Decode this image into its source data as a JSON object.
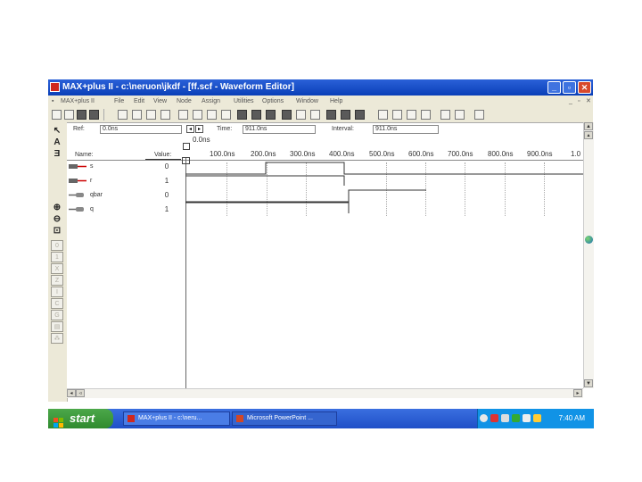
{
  "window": {
    "title": "MAX+plus II - c:\\neruon\\jkdf - [ff.scf - Waveform Editor]",
    "buttons": {
      "minimize": "_",
      "maximize": "▫",
      "close": "✕"
    }
  },
  "menu": {
    "items": [
      "MAX+plus II",
      "File",
      "Edit",
      "View",
      "Node",
      "Assign",
      "Utilities",
      "Options",
      "Window",
      "Help"
    ]
  },
  "fields": {
    "ref_label": "Ref:",
    "ref_value": "0.0ns",
    "time_label": "Time:",
    "time_value": "911.0ns",
    "interval_label": "Interval:",
    "interval_value": "911.0ns",
    "cursor_time": "0.0ns"
  },
  "columns": {
    "name": "Name:",
    "value": "Value:"
  },
  "signals": [
    {
      "name": "s",
      "value": "0",
      "type": "input"
    },
    {
      "name": "r",
      "value": "1",
      "type": "input"
    },
    {
      "name": "qbar",
      "value": "0",
      "type": "output"
    },
    {
      "name": "q",
      "value": "1",
      "type": "output"
    }
  ],
  "timescale": [
    "100.0ns",
    "200.0ns",
    "300.0ns",
    "400.0ns",
    "500.0ns",
    "600.0ns",
    "700.0ns",
    "800.0ns",
    "900.0ns",
    "1.0"
  ],
  "taskbar": {
    "start": "start",
    "tasks": [
      "MAX+plus II - c:\\neru...",
      "Microsoft PowerPoint ..."
    ],
    "clock": "7:40 AM"
  },
  "icons": [
    "app-icon",
    "zoom-in-icon",
    "zoom-out-icon",
    "pointer-icon",
    "text-tool-icon",
    "node-icon"
  ],
  "colors": {
    "titlebar": "#0a3fb8",
    "taskbar": "#245edb",
    "start": "#3c9a3a",
    "tray": "#1193e6"
  }
}
